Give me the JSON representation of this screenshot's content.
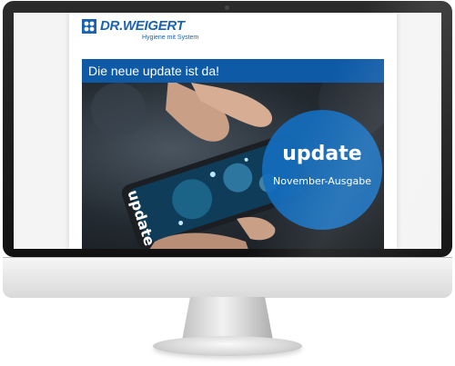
{
  "email": {
    "logo": {
      "brand": "DR.WEIGERT",
      "tagline": "Hygiene mit System"
    },
    "banner": {
      "title": "Die neue update ist da!"
    },
    "hero": {
      "badge_title": "update",
      "badge_subtitle": "November-Ausgabe",
      "phone_screen_text": "update"
    }
  },
  "colors": {
    "brand_blue": "#1a63b3",
    "banner_blue": "#0e5aa7",
    "badge_blue": "#146ebe"
  }
}
